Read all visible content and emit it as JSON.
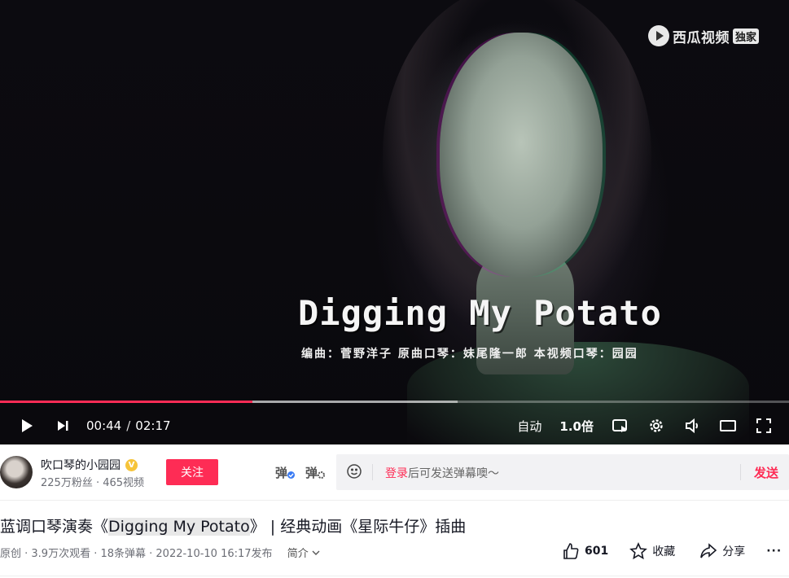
{
  "player": {
    "watermark": {
      "brand": "西瓜视频",
      "badge": "独家"
    },
    "overlay_title": "Digging My Potato",
    "overlay_credits": "编曲：菅野洋子 原曲口琴：妹尾隆一郎 本视频口琴：园园",
    "progress": {
      "played_fraction": 0.32,
      "buffered_fraction": 0.58
    },
    "time": {
      "current": "00:44",
      "separator": "/",
      "total": "02:17"
    },
    "controls": {
      "auto_label": "自动",
      "speed_label": "1.0倍"
    },
    "accent_color": "#fe2c55"
  },
  "author": {
    "name": "吹口琴的小园园",
    "verified_badge": "V",
    "stats": "225万粉丝 · 465视频",
    "follow_label": "关注"
  },
  "danmu": {
    "toggle_icon_label": "弹",
    "settings_icon_label": "弹",
    "prompt_login": "登录",
    "prompt_rest": "后可发送弹幕噢～",
    "send_label": "发送"
  },
  "video": {
    "title_prefix": "蓝调口琴演奏《",
    "title_highlight": "Digging My Potato",
    "title_suffix": "》 | 经典动画《星际牛仔》插曲",
    "meta": "原创 · 3.9万次观看 · 18条弹幕 · 2022-10-10 16:17发布",
    "intro_label": "简介",
    "like_count": "601",
    "collect_label": "收藏",
    "share_label": "分享",
    "more_label": "···"
  }
}
